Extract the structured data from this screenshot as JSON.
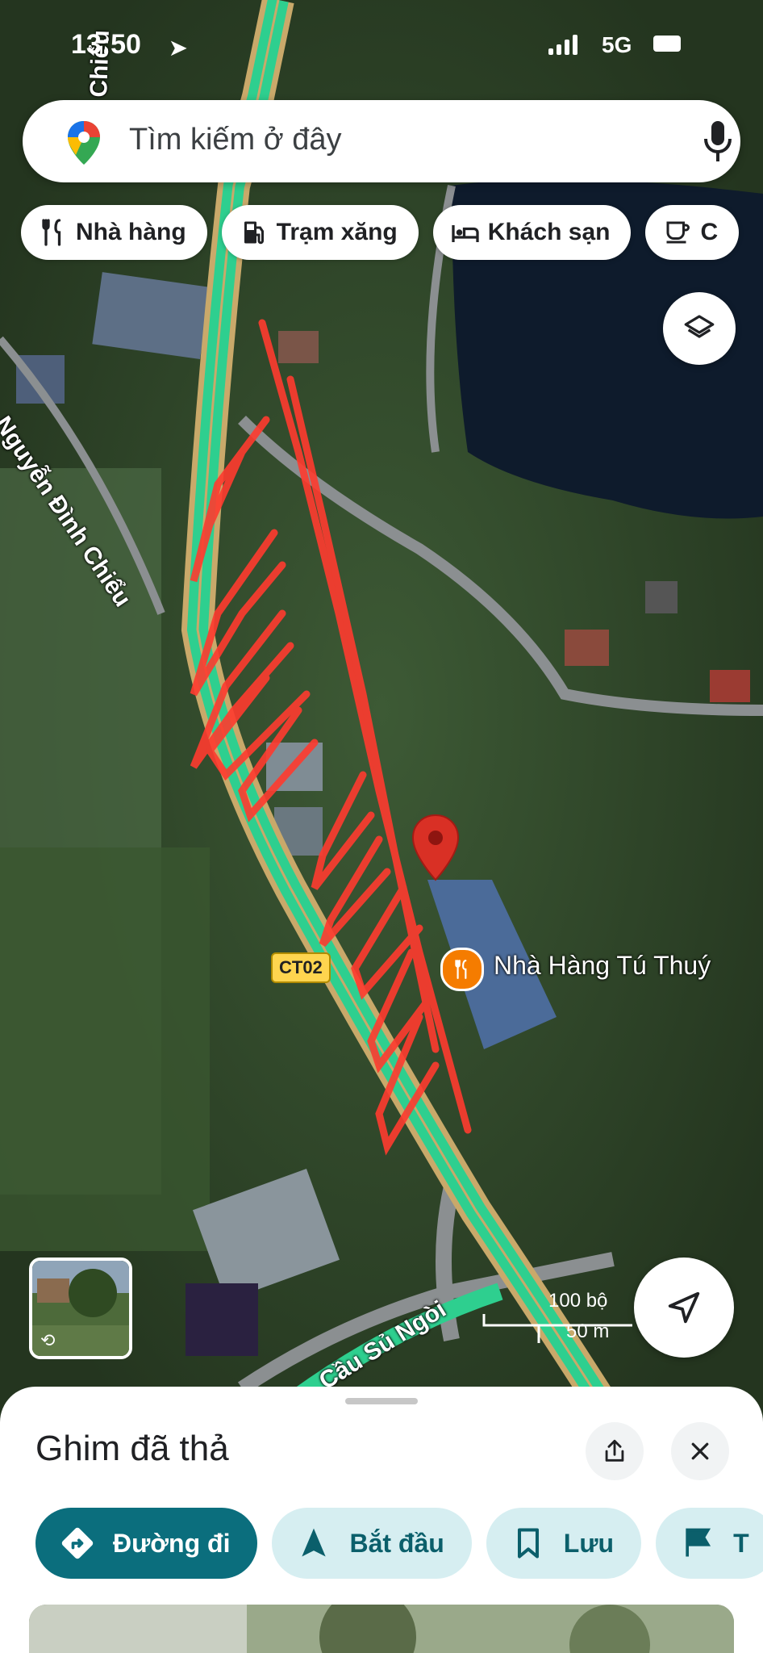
{
  "status_bar": {
    "time": "13:50",
    "network": "5G"
  },
  "search": {
    "placeholder": "Tìm kiếm ở đây"
  },
  "chips": [
    {
      "label": "Nhà hàng",
      "icon": "restaurant-icon"
    },
    {
      "label": "Trạm xăng",
      "icon": "gas-station-icon"
    },
    {
      "label": "Khách sạn",
      "icon": "hotel-icon"
    },
    {
      "label": "C",
      "icon": "coffee-icon"
    }
  ],
  "map": {
    "streets": {
      "top_vertical": "Chiểu",
      "left": "Nguyễn Đình Chiểu",
      "bottom": "Cầu Sủ Ngòi",
      "bottom_right": "Cầu Sủ Ngòi partial"
    },
    "road_badge": "CT02",
    "poi": {
      "name": "Nhà Hàng Tú Thuý",
      "icon": "restaurant-icon"
    },
    "scale": {
      "feet": "100 bộ",
      "meters": "50 m"
    }
  },
  "sheet": {
    "title": "Ghim đã thả",
    "actions": [
      {
        "label": "Đường đi",
        "icon": "directions-icon",
        "primary": true
      },
      {
        "label": "Bắt đầu",
        "icon": "navigation-icon",
        "primary": false
      },
      {
        "label": "Lưu",
        "icon": "bookmark-icon",
        "primary": false
      },
      {
        "label": "T",
        "icon": "flag-icon",
        "primary": false
      }
    ]
  },
  "colors": {
    "accent": "#0b6e7d",
    "marker": "#d93025",
    "route": "#2ecf8f"
  }
}
